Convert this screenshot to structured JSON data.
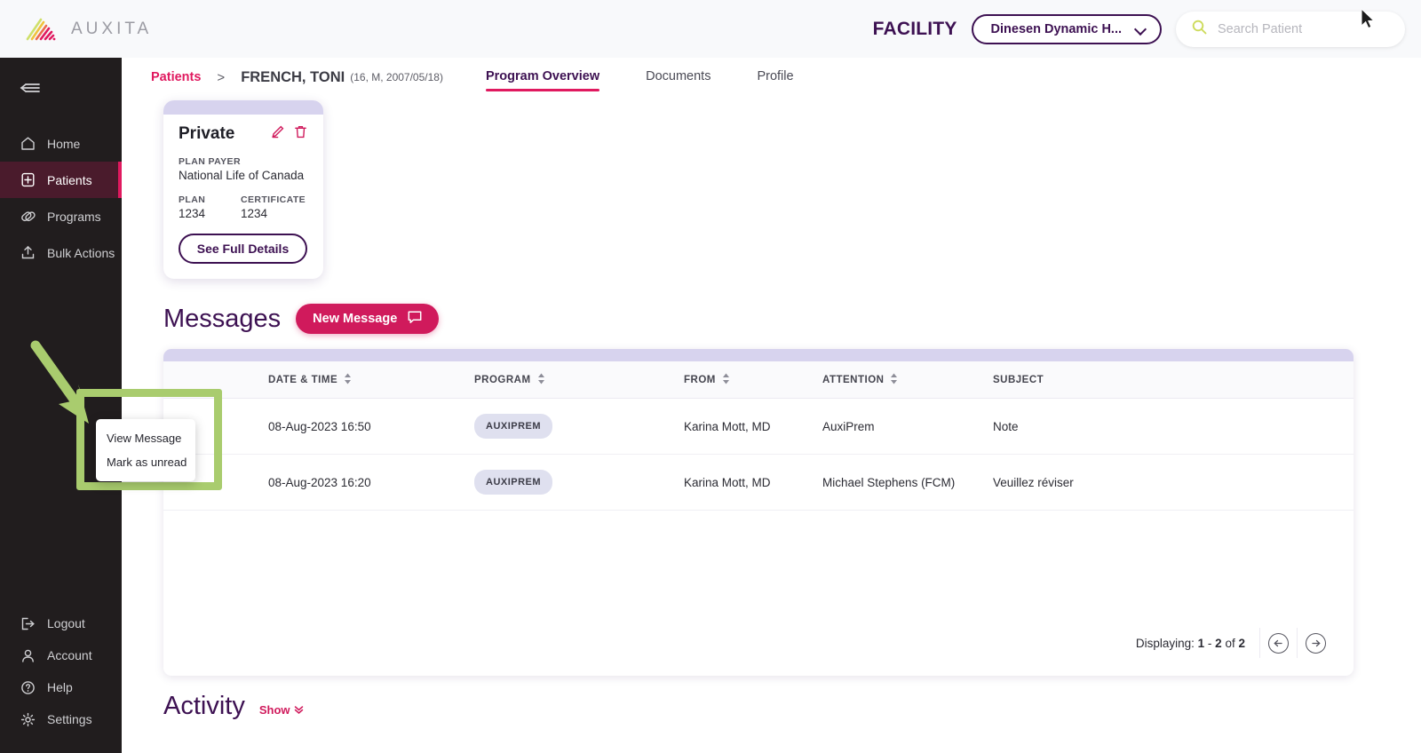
{
  "brand": {
    "name": "AUXITA",
    "logo_icon": "auxita-logo-icon"
  },
  "header": {
    "facility_label": "FACILITY",
    "facility_value": "Dinesen Dynamic H...",
    "facility_chevron_icon": "chevron-down-icon",
    "search": {
      "placeholder": "Search Patient",
      "value": "",
      "icon": "search-icon"
    }
  },
  "sidebar": {
    "collapse_icon": "collapse-sidebar-icon",
    "top_items": [
      {
        "label": "Home",
        "icon": "home-icon",
        "active": false
      },
      {
        "label": "Patients",
        "icon": "patients-icon",
        "active": true
      },
      {
        "label": "Programs",
        "icon": "programs-pills-icon",
        "active": false
      },
      {
        "label": "Bulk Actions",
        "icon": "upload-icon",
        "active": false
      }
    ],
    "bottom_items": [
      {
        "label": "Logout",
        "icon": "logout-icon"
      },
      {
        "label": "Account",
        "icon": "person-icon"
      },
      {
        "label": "Help",
        "icon": "question-circle-icon"
      },
      {
        "label": "Settings",
        "icon": "gear-icon"
      }
    ],
    "active_color": "#4a1b2c",
    "accent_color": "#e0195f"
  },
  "breadcrumb": {
    "root": "Patients",
    "separator": ">",
    "patient_name": "FRENCH, TONI",
    "patient_meta": "(16, M, 2007/05/18)"
  },
  "tabs": [
    {
      "label": "Program Overview",
      "active": true
    },
    {
      "label": "Documents",
      "active": false
    },
    {
      "label": "Profile",
      "active": false
    }
  ],
  "insurance_card": {
    "title": "Private",
    "edit_icon": "pencil-edit-icon",
    "delete_icon": "trash-delete-icon",
    "plan_payer_label": "PLAN PAYER",
    "plan_payer_value": "National Life of Canada",
    "plan_label": "PLAN",
    "plan_value": "1234",
    "certificate_label": "CERTIFICATE",
    "certificate_value": "1234",
    "details_button": "See Full Details"
  },
  "messages": {
    "title": "Messages",
    "new_message_button": "New Message",
    "new_message_icon": "speech-bubble-icon",
    "columns": [
      {
        "key": "menu",
        "label": "",
        "sortable": false
      },
      {
        "key": "date",
        "label": "DATE & TIME",
        "sortable": true
      },
      {
        "key": "program",
        "label": "PROGRAM",
        "sortable": true
      },
      {
        "key": "from",
        "label": "FROM",
        "sortable": true
      },
      {
        "key": "attention",
        "label": "ATTENTION",
        "sortable": true
      },
      {
        "key": "subject",
        "label": "SUBJECT",
        "sortable": false
      }
    ],
    "rows": [
      {
        "date": "08-Aug-2023 16:50",
        "program": "AUXIPREM",
        "from": "Karina Mott, MD",
        "attention": "AuxiPrem",
        "subject": "Note"
      },
      {
        "date": "08-Aug-2023 16:20",
        "program": "AUXIPREM",
        "from": "Karina Mott, MD",
        "attention": "Michael Stephens (FCM)",
        "subject": "Veuillez réviser"
      }
    ],
    "pagination": {
      "prefix": "Displaying:",
      "from": "1",
      "dash": "-",
      "to": "2",
      "of_word": "of",
      "total": "2",
      "prev_icon": "arrow-left-circle-icon",
      "next_icon": "arrow-right-circle-icon"
    }
  },
  "context_menu": {
    "items": [
      {
        "label": "View Message"
      },
      {
        "label": "Mark as unread"
      }
    ],
    "trigger_icon": "kebab-menu-icon"
  },
  "activity": {
    "title": "Activity",
    "show_label": "Show",
    "show_icon": "double-chevron-down-icon"
  },
  "annotation": {
    "arrow_icon": "green-arrow-annotation",
    "highlight_icon": "green-highlight-box",
    "color": "#a9cc6e"
  },
  "cursor": {
    "icon": "mouse-pointer-icon"
  }
}
